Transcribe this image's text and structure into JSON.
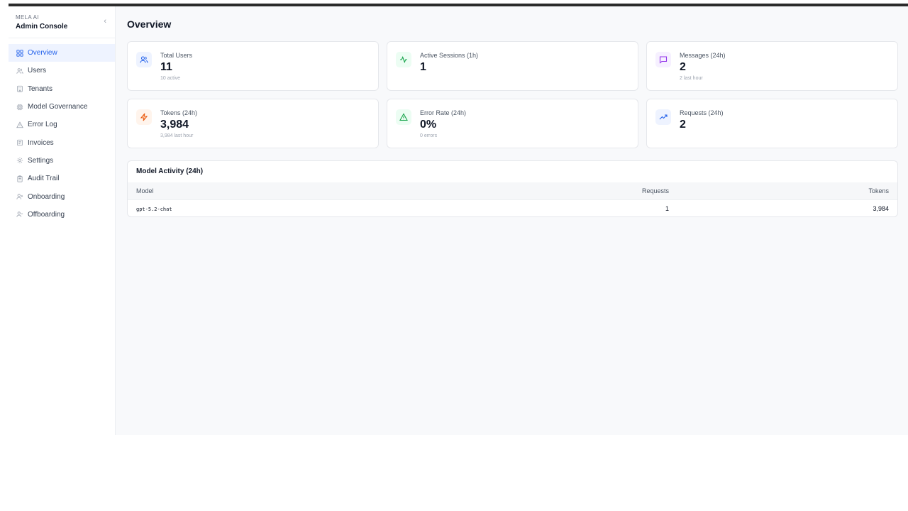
{
  "brand": {
    "subtitle": "MELA AI",
    "title": "Admin Console"
  },
  "sidebar": {
    "collapse_glyph": "‹",
    "items": [
      {
        "label": "Overview",
        "icon": "grid-icon",
        "active": true
      },
      {
        "label": "Users",
        "icon": "users-icon"
      },
      {
        "label": "Tenants",
        "icon": "building-icon"
      },
      {
        "label": "Model Governance",
        "icon": "cpu-icon"
      },
      {
        "label": "Error Log",
        "icon": "warning-icon"
      },
      {
        "label": "Invoices",
        "icon": "receipt-icon"
      },
      {
        "label": "Settings",
        "icon": "gear-icon"
      },
      {
        "label": "Audit Trail",
        "icon": "clipboard-icon"
      },
      {
        "label": "Onboarding",
        "icon": "user-plus-icon"
      },
      {
        "label": "Offboarding",
        "icon": "user-minus-icon"
      }
    ]
  },
  "page": {
    "title": "Overview"
  },
  "stats": [
    {
      "label": "Total Users",
      "value": "11",
      "sub": "10 active",
      "icon": "users-icon",
      "color": "#2563eb",
      "bg": "#eef3ff"
    },
    {
      "label": "Active Sessions (1h)",
      "value": "1",
      "sub": "",
      "icon": "activity-icon",
      "color": "#16a34a",
      "bg": "#ecfdf3"
    },
    {
      "label": "Messages (24h)",
      "value": "2",
      "sub": "2 last hour",
      "icon": "message-icon",
      "color": "#9333ea",
      "bg": "#f6f0ff"
    },
    {
      "label": "Tokens (24h)",
      "value": "3,984",
      "sub": "3,984 last hour",
      "icon": "zap-icon",
      "color": "#ea580c",
      "bg": "#fff4ec"
    },
    {
      "label": "Error Rate (24h)",
      "value": "0%",
      "sub": "0 errors",
      "icon": "warning-icon",
      "color": "#16a34a",
      "bg": "#ecfdf3"
    },
    {
      "label": "Requests (24h)",
      "value": "2",
      "sub": "",
      "icon": "trending-up-icon",
      "color": "#2563eb",
      "bg": "#eef3ff"
    }
  ],
  "model_activity": {
    "title": "Model Activity (24h)",
    "columns": [
      "Model",
      "Requests",
      "Tokens"
    ],
    "rows": [
      {
        "model": "gpt-5.2-chat",
        "requests": "1",
        "tokens": "3,984"
      }
    ]
  }
}
